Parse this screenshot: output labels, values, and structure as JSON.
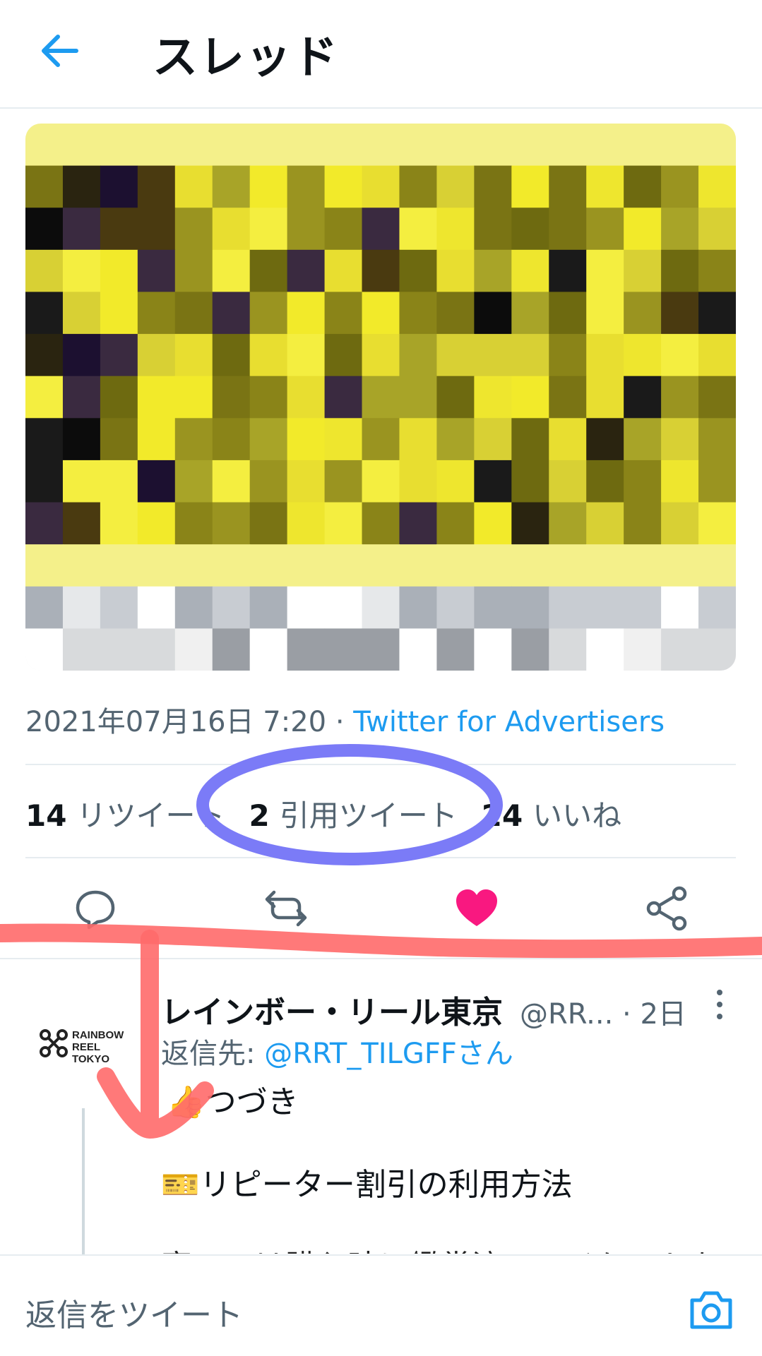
{
  "header": {
    "title": "スレッド",
    "back_icon": "arrow-left-icon"
  },
  "tweet": {
    "datetime": "2021年07月16日 7:20",
    "separator": " · ",
    "source": "Twitter for Advertisers",
    "stats": {
      "retweets": {
        "count": "14",
        "label": "リツイート"
      },
      "quotes": {
        "count": "2",
        "label": "引用ツイート"
      },
      "likes": {
        "count": "24",
        "label": "いいね"
      }
    },
    "actions": [
      "reply-icon",
      "retweet-icon",
      "like-icon",
      "share-icon"
    ]
  },
  "reply": {
    "avatar_text": [
      "RAINBOW",
      "REEL",
      "TOKYO"
    ],
    "name": "レインボー・リール東京",
    "handle": "@RR...",
    "time": "· 2日",
    "reply_to_label": "返信先: ",
    "reply_to_mention": "@RRT_TILGFFさん",
    "line1_emoji": "👍",
    "line1": "つづき",
    "line2_emoji": "🎫",
    "line2": "リピーター割引の利用方法",
    "line3": "窓口では購入時に鑑賞済みのチケットを"
  },
  "compose": {
    "placeholder": "返信をツイート",
    "camera_icon": "camera-icon"
  },
  "colors": {
    "accent": "#1d9bf0",
    "like": "#f91880",
    "annotation_blue": "#7b7bf7",
    "annotation_red": "#ff6a6a"
  }
}
